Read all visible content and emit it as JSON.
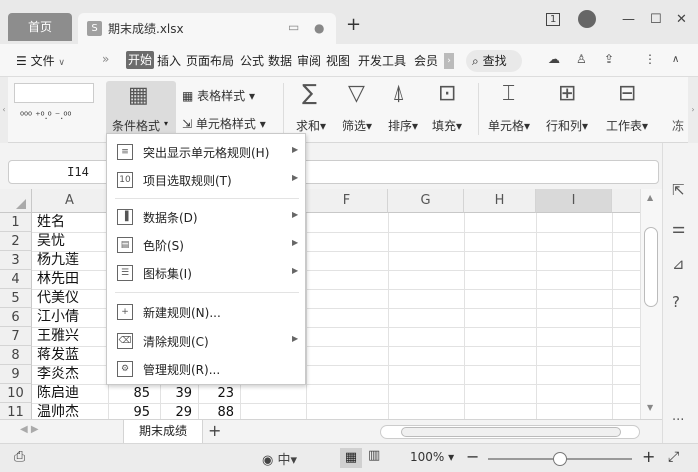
{
  "titlebar": {
    "home_tab": "首页",
    "file_tab": "期末成绩.xlsx",
    "file_icon": "S",
    "new_tab": "+",
    "window_count": "1"
  },
  "menubar": {
    "menu_button": "☰ 文件",
    "more": "»",
    "items": [
      "开始",
      "插入",
      "页面布局",
      "公式",
      "数据",
      "审阅",
      "视图",
      "开发工具",
      "会员"
    ],
    "search": "查找"
  },
  "ribbon": {
    "conditional_format": "条件格式",
    "table_style": "表格样式",
    "cell_style": "单元格样式",
    "sum": "求和",
    "filter": "筛选",
    "sort": "排序",
    "fill": "填充",
    "cell": "单元格",
    "row_col": "行和列",
    "worksheet": "工作表",
    "more_label": "冻"
  },
  "formula_bar": {
    "name_box": "I14",
    "formula": ""
  },
  "grid": {
    "columns": [
      "A",
      "F",
      "G",
      "H",
      "I"
    ],
    "row_numbers": [
      "1",
      "2",
      "3",
      "4",
      "5",
      "6",
      "7",
      "8",
      "9",
      "10",
      "11"
    ],
    "names": [
      "姓名",
      "吴忧",
      "杨九莲",
      "林先田",
      "代美仪",
      "江小倩",
      "王雅兴",
      "蒋发蓝",
      "李炎杰",
      "陈启迪",
      "温帅杰"
    ],
    "row10_values": [
      "85",
      "39",
      "23"
    ],
    "row11_values": [
      "95",
      "29",
      "88"
    ]
  },
  "dropdown": {
    "items": [
      {
        "label": "突出显示单元格规则(H)",
        "arrow": true
      },
      {
        "label": "项目选取规则(T)",
        "arrow": true
      },
      {
        "label": "数据条(D)",
        "arrow": true
      },
      {
        "label": "色阶(S)",
        "arrow": true
      },
      {
        "label": "图标集(I)",
        "arrow": true
      },
      {
        "label": "新建规则(N)...",
        "arrow": false
      },
      {
        "label": "清除规则(C)",
        "arrow": true
      },
      {
        "label": "管理规则(R)...",
        "arrow": false
      }
    ]
  },
  "sheet_tabs": {
    "active": "期末成绩",
    "add": "+"
  },
  "statusbar": {
    "zoom": "100%",
    "minus": "−",
    "plus": "+"
  }
}
